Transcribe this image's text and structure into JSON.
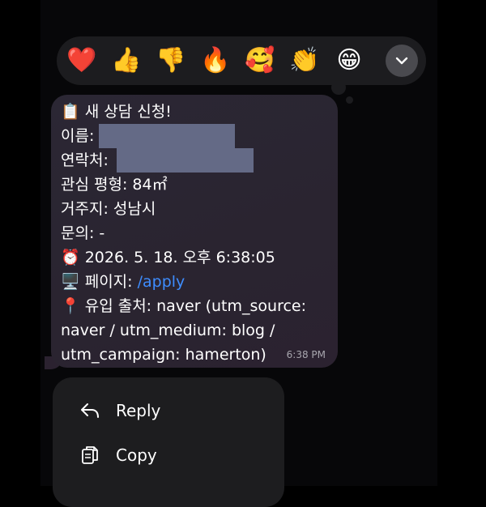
{
  "reactions": [
    {
      "emoji": "❤️",
      "name": "heart"
    },
    {
      "emoji": "👍",
      "name": "thumbs-up"
    },
    {
      "emoji": "👎",
      "name": "thumbs-down"
    },
    {
      "emoji": "🔥",
      "name": "fire"
    },
    {
      "emoji": "🥰",
      "name": "smiling-hearts"
    },
    {
      "emoji": "👏",
      "name": "clapping"
    },
    {
      "emoji": "😁",
      "name": "grinning"
    }
  ],
  "message": {
    "title_icon": "📋",
    "title": "새 상담 신청!",
    "name_label": "이름:",
    "contact_label": "연락처:",
    "interest": "관심 평형: 84㎡",
    "residence": "거주지: 성남시",
    "inquiry": "문의: -",
    "datetime_icon": "⏰",
    "datetime": "2026. 5. 18. 오후 6:38:05",
    "page_icon": "🖥️",
    "page_label": "페이지:",
    "page_link": "/apply",
    "source_icon": "📍",
    "source_line1": "유입 출처: naver (utm_source:",
    "source_line2": "naver / utm_medium: blog /",
    "source_line3": "utm_campaign: hamerton)",
    "time": "6:38 PM"
  },
  "context_menu": {
    "reply_label": "Reply",
    "copy_label": "Copy"
  },
  "colors": {
    "link": "#3e8dff",
    "redaction": "#646a86"
  }
}
